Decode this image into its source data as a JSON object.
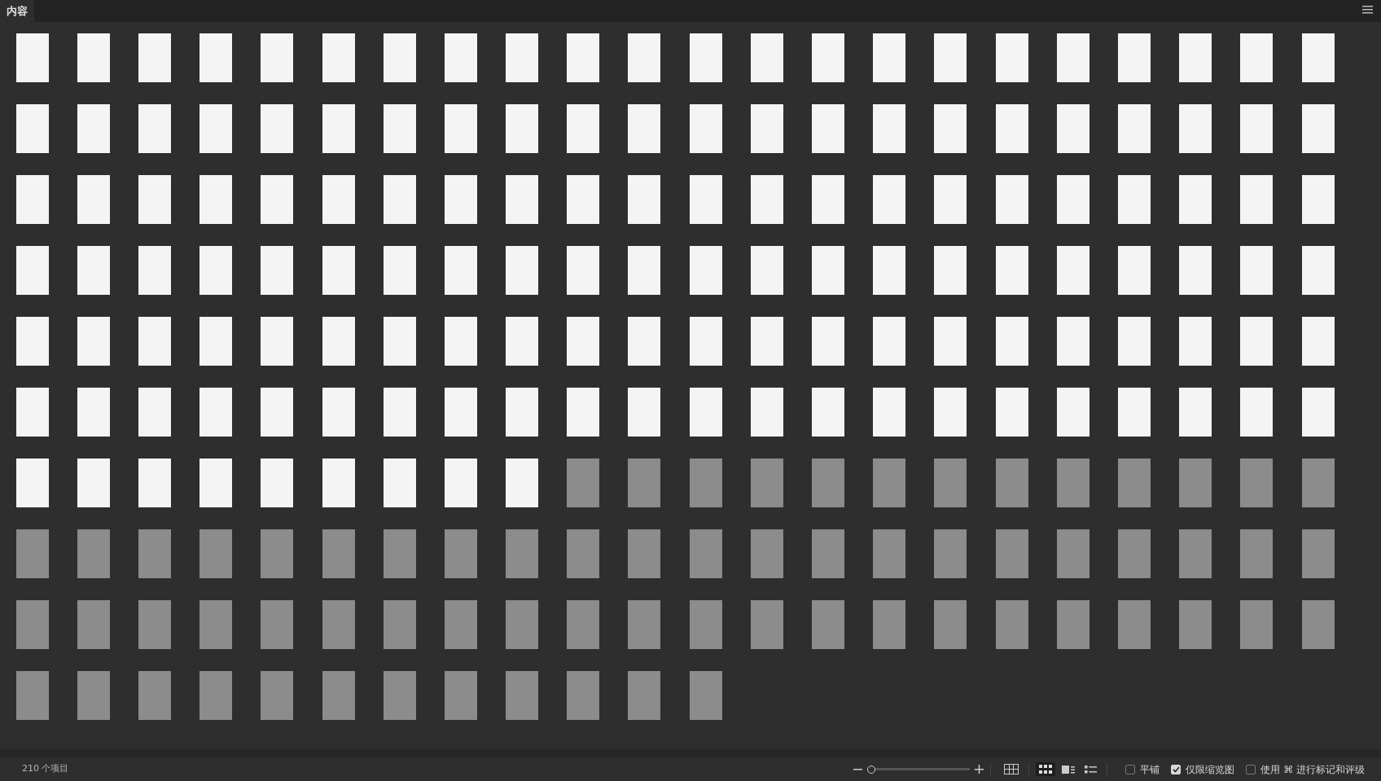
{
  "panel_tab": {
    "label": "内容",
    "selected": true
  },
  "thumbnails": [
    {
      "kind": "color"
    },
    {
      "kind": "color"
    },
    {
      "kind": "color"
    },
    {
      "kind": "color"
    },
    {
      "kind": "color"
    },
    {
      "kind": "color"
    },
    {
      "kind": "color"
    },
    {
      "kind": "color"
    },
    {
      "kind": "color"
    },
    {
      "kind": "color"
    },
    {
      "kind": "color"
    },
    {
      "kind": "color"
    },
    {
      "kind": "color"
    },
    {
      "kind": "color"
    },
    {
      "kind": "color"
    },
    {
      "kind": "color"
    },
    {
      "kind": "color"
    },
    {
      "kind": "color"
    },
    {
      "kind": "color"
    },
    {
      "kind": "color"
    },
    {
      "kind": "color"
    },
    {
      "kind": "color"
    },
    {
      "kind": "color"
    },
    {
      "kind": "color"
    },
    {
      "kind": "color"
    },
    {
      "kind": "color"
    },
    {
      "kind": "color"
    },
    {
      "kind": "color"
    },
    {
      "kind": "color"
    },
    {
      "kind": "color"
    },
    {
      "kind": "color"
    },
    {
      "kind": "color"
    },
    {
      "kind": "color"
    },
    {
      "kind": "color"
    },
    {
      "kind": "color"
    },
    {
      "kind": "color"
    },
    {
      "kind": "color"
    },
    {
      "kind": "color"
    },
    {
      "kind": "color"
    },
    {
      "kind": "color"
    },
    {
      "kind": "color"
    },
    {
      "kind": "color"
    },
    {
      "kind": "color"
    },
    {
      "kind": "color"
    },
    {
      "kind": "color"
    },
    {
      "kind": "color"
    },
    {
      "kind": "color"
    },
    {
      "kind": "color"
    },
    {
      "kind": "color"
    },
    {
      "kind": "color"
    },
    {
      "kind": "color"
    },
    {
      "kind": "color"
    },
    {
      "kind": "color"
    },
    {
      "kind": "color"
    },
    {
      "kind": "color"
    },
    {
      "kind": "color"
    },
    {
      "kind": "color"
    },
    {
      "kind": "color"
    },
    {
      "kind": "color"
    },
    {
      "kind": "color"
    },
    {
      "kind": "color"
    },
    {
      "kind": "color"
    },
    {
      "kind": "color"
    },
    {
      "kind": "color"
    },
    {
      "kind": "color"
    },
    {
      "kind": "color"
    },
    {
      "kind": "color"
    },
    {
      "kind": "color"
    },
    {
      "kind": "color"
    },
    {
      "kind": "color"
    },
    {
      "kind": "color"
    },
    {
      "kind": "color"
    },
    {
      "kind": "color"
    },
    {
      "kind": "color"
    },
    {
      "kind": "color"
    },
    {
      "kind": "color"
    },
    {
      "kind": "color"
    },
    {
      "kind": "color"
    },
    {
      "kind": "color"
    },
    {
      "kind": "color"
    },
    {
      "kind": "color"
    },
    {
      "kind": "color"
    },
    {
      "kind": "color"
    },
    {
      "kind": "color"
    },
    {
      "kind": "color"
    },
    {
      "kind": "color"
    },
    {
      "kind": "color"
    },
    {
      "kind": "color"
    },
    {
      "kind": "color"
    },
    {
      "kind": "color"
    },
    {
      "kind": "color"
    },
    {
      "kind": "color"
    },
    {
      "kind": "color"
    },
    {
      "kind": "color"
    },
    {
      "kind": "color"
    },
    {
      "kind": "color"
    },
    {
      "kind": "color"
    },
    {
      "kind": "color"
    },
    {
      "kind": "color"
    },
    {
      "kind": "color"
    },
    {
      "kind": "color"
    },
    {
      "kind": "color"
    },
    {
      "kind": "color"
    },
    {
      "kind": "color"
    },
    {
      "kind": "color"
    },
    {
      "kind": "color"
    },
    {
      "kind": "color"
    },
    {
      "kind": "color"
    },
    {
      "kind": "color"
    },
    {
      "kind": "color"
    },
    {
      "kind": "color"
    },
    {
      "kind": "color"
    },
    {
      "kind": "color"
    },
    {
      "kind": "color"
    },
    {
      "kind": "color"
    },
    {
      "kind": "color"
    },
    {
      "kind": "color"
    },
    {
      "kind": "color"
    },
    {
      "kind": "color"
    },
    {
      "kind": "color"
    },
    {
      "kind": "color"
    },
    {
      "kind": "color"
    },
    {
      "kind": "color"
    },
    {
      "kind": "color"
    },
    {
      "kind": "color"
    },
    {
      "kind": "color"
    },
    {
      "kind": "color"
    },
    {
      "kind": "color"
    },
    {
      "kind": "color"
    },
    {
      "kind": "color"
    },
    {
      "kind": "color"
    },
    {
      "kind": "color"
    },
    {
      "kind": "color"
    },
    {
      "kind": "color"
    },
    {
      "kind": "color"
    },
    {
      "kind": "color"
    },
    {
      "kind": "color"
    },
    {
      "kind": "color"
    },
    {
      "kind": "color"
    },
    {
      "kind": "color"
    },
    {
      "kind": "color"
    },
    {
      "kind": "mono"
    },
    {
      "kind": "mono"
    },
    {
      "kind": "mono"
    },
    {
      "kind": "mono"
    },
    {
      "kind": "mono"
    },
    {
      "kind": "mono"
    },
    {
      "kind": "mono"
    },
    {
      "kind": "mono"
    },
    {
      "kind": "mono"
    },
    {
      "kind": "mono"
    },
    {
      "kind": "mono"
    },
    {
      "kind": "mono"
    },
    {
      "kind": "mono"
    },
    {
      "kind": "mono"
    },
    {
      "kind": "mono"
    },
    {
      "kind": "mono"
    },
    {
      "kind": "mono"
    },
    {
      "kind": "mono"
    },
    {
      "kind": "mono"
    },
    {
      "kind": "mono"
    },
    {
      "kind": "mono"
    },
    {
      "kind": "mono"
    },
    {
      "kind": "mono"
    },
    {
      "kind": "mono"
    },
    {
      "kind": "mono"
    },
    {
      "kind": "mono"
    },
    {
      "kind": "mono"
    },
    {
      "kind": "mono"
    },
    {
      "kind": "mono"
    },
    {
      "kind": "mono"
    },
    {
      "kind": "mono"
    },
    {
      "kind": "mono"
    },
    {
      "kind": "mono"
    },
    {
      "kind": "mono"
    },
    {
      "kind": "mono"
    },
    {
      "kind": "mono"
    },
    {
      "kind": "mono"
    },
    {
      "kind": "mono"
    },
    {
      "kind": "mono"
    },
    {
      "kind": "mono"
    },
    {
      "kind": "mono"
    },
    {
      "kind": "mono"
    },
    {
      "kind": "mono"
    },
    {
      "kind": "mono"
    },
    {
      "kind": "mono"
    },
    {
      "kind": "mono"
    },
    {
      "kind": "mono"
    },
    {
      "kind": "mono"
    },
    {
      "kind": "mono"
    },
    {
      "kind": "mono"
    },
    {
      "kind": "mono"
    },
    {
      "kind": "mono"
    },
    {
      "kind": "mono"
    },
    {
      "kind": "mono"
    },
    {
      "kind": "mono"
    },
    {
      "kind": "mono"
    },
    {
      "kind": "mono"
    },
    {
      "kind": "mono"
    },
    {
      "kind": "mono"
    },
    {
      "kind": "mono"
    },
    {
      "kind": "mono"
    },
    {
      "kind": "mono"
    },
    {
      "kind": "mono"
    },
    {
      "kind": "mono"
    },
    {
      "kind": "mono"
    },
    {
      "kind": "mono"
    },
    {
      "kind": "mono"
    },
    {
      "kind": "mono"
    },
    {
      "kind": "mono"
    }
  ],
  "status_bar": {
    "item_count": "210 个项目",
    "thumbnail_size": {
      "level": 0.0
    },
    "view_modes": [
      {
        "kind": "grid-lines",
        "selected": false
      },
      {
        "kind": "thumbnails",
        "selected": true
      },
      {
        "kind": "details",
        "selected": false
      },
      {
        "kind": "list",
        "selected": false
      }
    ],
    "options": [
      {
        "label": "平铺",
        "checked": false
      },
      {
        "label": "仅限缩览图",
        "checked": true
      },
      {
        "label": "使用 ⌘ 进行标记和评级",
        "checked": false
      }
    ]
  }
}
